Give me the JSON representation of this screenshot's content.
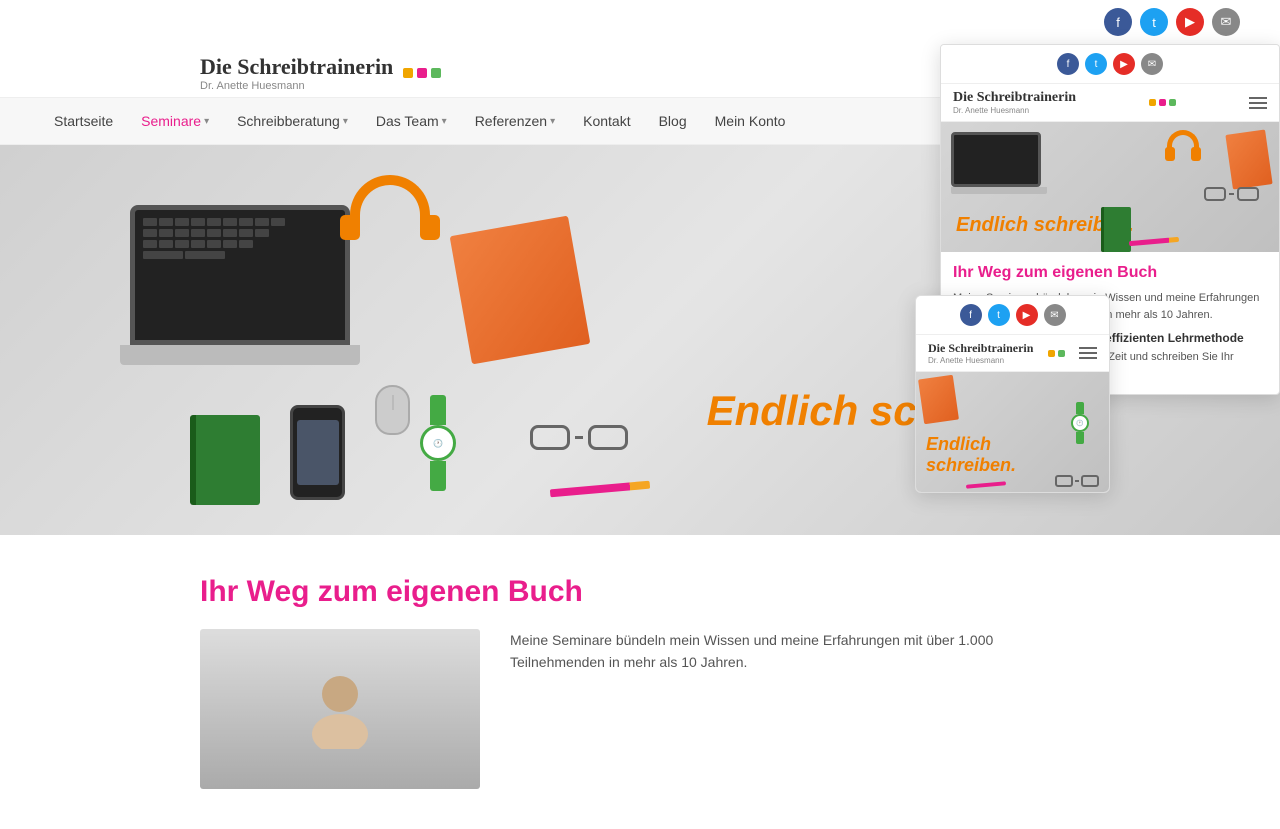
{
  "site": {
    "name": "Die Schreibtrainerin",
    "subtitle": "Dr. Anette Huesmann"
  },
  "social": {
    "icons": [
      "fb",
      "tw",
      "yt",
      "em"
    ]
  },
  "nav": {
    "items": [
      {
        "label": "Startseite",
        "active": false,
        "hasDropdown": false
      },
      {
        "label": "Seminare",
        "active": true,
        "hasDropdown": true
      },
      {
        "label": "Schreibberatung",
        "active": false,
        "hasDropdown": true
      },
      {
        "label": "Das Team",
        "active": false,
        "hasDropdown": true
      },
      {
        "label": "Referenzen",
        "active": false,
        "hasDropdown": true
      },
      {
        "label": "Kontakt",
        "active": false,
        "hasDropdown": false
      },
      {
        "label": "Blog",
        "active": false,
        "hasDropdown": false
      },
      {
        "label": "Mein Konto",
        "active": false,
        "hasDropdown": false
      }
    ]
  },
  "hero": {
    "tagline": "Endlich schreiben."
  },
  "content": {
    "section_title": "Ihr Weg zum eigenen Buch",
    "body_text": "Meine Seminare bündeln mein Wissen und meine Erfahrungen mit über 1.000 Teilnehmenden in mehr als 10 Jahren."
  },
  "desktop_overlay": {
    "hero_tagline": "Endlich schreiben.",
    "section_title": "Ihr Weg zum eigenen Buch",
    "body_text": "Meine Seminare bündeln mein Wissen und meine Erfahrungen mit über 1.000 Teilnehmenden in mehr als 10 Jahren.",
    "subheading": "Profitieren Sie von meiner effizienten Lehrmethode",
    "subtext": "Erhalten Sie viel Input in kurzer Zeit und schreiben Sie Ihr eigenes Buch."
  },
  "tablet_overlay": {
    "hero_tagline_line1": "Endlich",
    "hero_tagline_line2": "schreiben."
  }
}
